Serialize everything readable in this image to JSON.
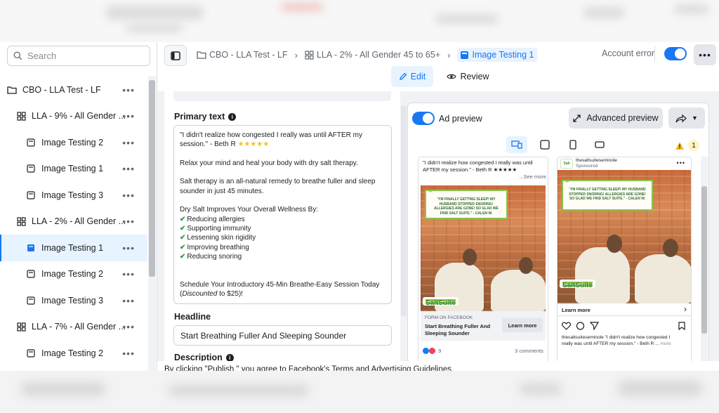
{
  "sidebar": {
    "search_placeholder": "Search",
    "items": [
      {
        "label": "CBO - LLA Test - LF",
        "type": "campaign"
      },
      {
        "label": "LLA - 9% - All Gender ...",
        "type": "adset"
      },
      {
        "label": "Image Testing 2",
        "type": "ad"
      },
      {
        "label": "Image Testing 1",
        "type": "ad"
      },
      {
        "label": "Image Testing 3",
        "type": "ad"
      },
      {
        "label": "LLA - 2% - All Gender ...",
        "type": "adset"
      },
      {
        "label": "Image Testing 1",
        "type": "ad",
        "selected": true
      },
      {
        "label": "Image Testing 2",
        "type": "ad"
      },
      {
        "label": "Image Testing 3",
        "type": "ad"
      },
      {
        "label": "LLA - 7% - All Gender ...",
        "type": "adset"
      },
      {
        "label": "Image Testing 2",
        "type": "ad"
      }
    ]
  },
  "breadcrumb": {
    "campaign": "CBO - LLA Test - LF",
    "adset": "LLA - 2% - All Gender 45 to 65+",
    "ad": "Image Testing 1"
  },
  "header": {
    "status": "Account error",
    "edit_label": "Edit",
    "review_label": "Review"
  },
  "editor": {
    "primary_text_label": "Primary text",
    "primary_text": {
      "line1": "\"I didn't realize how congested I really was until AFTER my",
      "line2": "session.\" - Beth R",
      "stars": "★★★★★",
      "p2": "Relax your mind and heal your body with dry salt therapy.",
      "p3a": "Salt therapy is an all-natural remedy to breathe fuller and sleep",
      "p3b": "sounder in just 45 minutes.",
      "p4": "Dry Salt Improves Your Overall Wellness By:",
      "benefits": [
        "Reducing allergies",
        "Supporting immunity",
        "Lessening skin rigidity",
        "Improving breathing",
        "Reducing snoring"
      ],
      "p5a": "Schedule Your Introductory 45-Min Breathe-Easy Session Today",
      "p5b_italic": "Discounted",
      "p5b_rest": " to $25)!"
    },
    "headline_label": "Headline",
    "headline_value": "Start Breathing Fuller And Sleeping Sounder",
    "description_label": "Description"
  },
  "footer_text": "By clicking \"Publish,\" you agree to Facebook's Terms and Advertising Guidelines",
  "preview": {
    "ad_preview_label": "Ad preview",
    "advanced_label": "Advanced preview",
    "warning_count": "1",
    "fb_card": {
      "text1": "\"I didn't realize how congested I really was until",
      "text2": "AFTER my session.\" - Beth R ★★★★★",
      "see_more": "...See more",
      "quote": "\"I'M FINALLY GETTING SLEEP! MY HUSBAND STOPPED SNORING! ALLERGIES ARE GONE! SO GLAD WE FIND SALT SUITE.\" - CALEN W.",
      "brand": "SaltSuite",
      "form_label": "FORM ON FACEBOOK",
      "headline1": "Start Breathing Fuller And",
      "headline2": "Sleeping Sounder",
      "cta": "Learn more",
      "comments": "3 comments"
    },
    "ig_card": {
      "account": "thesaltsuiteseminole",
      "sponsored": "Sponsored",
      "quote": "\"I'M FINALLY GETTING SLEEP! MY HUSBAND STOPPED SNORING! ALLERGIES ARE GONE! SO GLAD WE FIND SALT SUITE.\" - CALEN W.",
      "brand": "SaltSuite",
      "cta": "Learn more",
      "cap1": "thesaltsuiteseminole \"I didn't realize how congested I",
      "cap2": "really was until AFTER my session.\" - Beth R ...",
      "more": "more"
    }
  },
  "colors": {
    "accent": "#1877f2",
    "selected_bg": "#e7f3ff",
    "check": "#2e9d3e"
  }
}
